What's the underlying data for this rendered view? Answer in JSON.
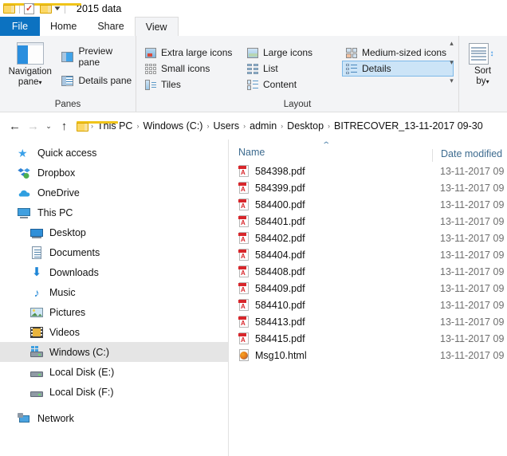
{
  "titlebar": {
    "window_title": "2015 data",
    "qat": [
      {
        "name": "explorer-icon",
        "label": "Explorer"
      },
      {
        "name": "properties-icon",
        "label": "Properties"
      },
      {
        "name": "new-folder-icon",
        "label": "New folder"
      }
    ],
    "customize_caret": "▼"
  },
  "tabs": [
    {
      "id": "file",
      "label": "File",
      "active": false
    },
    {
      "id": "home",
      "label": "Home",
      "active": false
    },
    {
      "id": "share",
      "label": "Share",
      "active": false
    },
    {
      "id": "view",
      "label": "View",
      "active": true
    }
  ],
  "ribbon": {
    "panes": {
      "group_label": "Panes",
      "navigation_pane": "Navigation pane",
      "navigation_caret": "▾",
      "preview_pane": "Preview pane",
      "details_pane": "Details pane"
    },
    "layout": {
      "group_label": "Layout",
      "items": [
        {
          "label": "Extra large icons",
          "selected": false
        },
        {
          "label": "Large icons",
          "selected": false
        },
        {
          "label": "Medium-sized icons",
          "selected": false
        },
        {
          "label": "Small icons",
          "selected": false
        },
        {
          "label": "List",
          "selected": false
        },
        {
          "label": "Details",
          "selected": true
        },
        {
          "label": "Tiles",
          "selected": false
        },
        {
          "label": "Content",
          "selected": false
        }
      ],
      "scroll_up": "▴",
      "scroll_down": "▾",
      "scroll_more": "▾"
    },
    "sort": {
      "line1": "Sort",
      "line2": "by",
      "caret": "▾"
    }
  },
  "addressbar": {
    "back": "←",
    "forward": "→",
    "recent": "⌄",
    "up": "↑",
    "separator": "›",
    "crumbs": [
      "This PC",
      "Windows (C:)",
      "Users",
      "admin",
      "Desktop",
      "BITRECOVER_13-11-2017 09-30"
    ]
  },
  "navpane": {
    "items": [
      {
        "label": "Quick access",
        "icon": "star-icon",
        "level": 0,
        "selected": false
      },
      {
        "label": "Dropbox",
        "icon": "dropbox-icon",
        "level": 0,
        "selected": false
      },
      {
        "label": "OneDrive",
        "icon": "onedrive-icon",
        "level": 0,
        "selected": false
      },
      {
        "label": "This PC",
        "icon": "computer-icon",
        "level": 0,
        "selected": false
      },
      {
        "label": "Desktop",
        "icon": "desktop-icon",
        "level": 1,
        "selected": false
      },
      {
        "label": "Documents",
        "icon": "documents-icon",
        "level": 1,
        "selected": false
      },
      {
        "label": "Downloads",
        "icon": "downloads-icon",
        "level": 1,
        "selected": false
      },
      {
        "label": "Music",
        "icon": "music-icon",
        "level": 1,
        "selected": false
      },
      {
        "label": "Pictures",
        "icon": "pictures-icon",
        "level": 1,
        "selected": false
      },
      {
        "label": "Videos",
        "icon": "videos-icon",
        "level": 1,
        "selected": false
      },
      {
        "label": "Windows (C:)",
        "icon": "windows-drive-icon",
        "level": 1,
        "selected": true
      },
      {
        "label": "Local Disk (E:)",
        "icon": "drive-icon",
        "level": 1,
        "selected": false
      },
      {
        "label": "Local Disk (F:)",
        "icon": "drive-icon",
        "level": 1,
        "selected": false
      },
      {
        "label": "Network",
        "icon": "network-icon",
        "level": 0,
        "selected": false
      }
    ]
  },
  "filelist": {
    "columns": [
      {
        "id": "name",
        "label": "Name",
        "sorted": true,
        "sort_direction": "asc",
        "sort_glyph": "⌃"
      },
      {
        "id": "date",
        "label": "Date modified",
        "sorted": false
      }
    ],
    "rows": [
      {
        "name": "584398.pdf",
        "type": "pdf",
        "date": "13-11-2017 09"
      },
      {
        "name": "584399.pdf",
        "type": "pdf",
        "date": "13-11-2017 09"
      },
      {
        "name": "584400.pdf",
        "type": "pdf",
        "date": "13-11-2017 09"
      },
      {
        "name": "584401.pdf",
        "type": "pdf",
        "date": "13-11-2017 09"
      },
      {
        "name": "584402.pdf",
        "type": "pdf",
        "date": "13-11-2017 09"
      },
      {
        "name": "584404.pdf",
        "type": "pdf",
        "date": "13-11-2017 09"
      },
      {
        "name": "584408.pdf",
        "type": "pdf",
        "date": "13-11-2017 09"
      },
      {
        "name": "584409.pdf",
        "type": "pdf",
        "date": "13-11-2017 09"
      },
      {
        "name": "584410.pdf",
        "type": "pdf",
        "date": "13-11-2017 09"
      },
      {
        "name": "584413.pdf",
        "type": "pdf",
        "date": "13-11-2017 09"
      },
      {
        "name": "584415.pdf",
        "type": "pdf",
        "date": "13-11-2017 09"
      },
      {
        "name": "Msg10.html",
        "type": "html",
        "date": "13-11-2017 09"
      }
    ]
  },
  "colors": {
    "file_tab_blue": "#0c72c1",
    "ribbon_bg": "#f3f4f6",
    "selection_blue": "#cce4f7",
    "nav_selected_grey": "#e5e5e5",
    "header_text_blue": "#3d6b8f",
    "pdf_red": "#d8262b"
  }
}
